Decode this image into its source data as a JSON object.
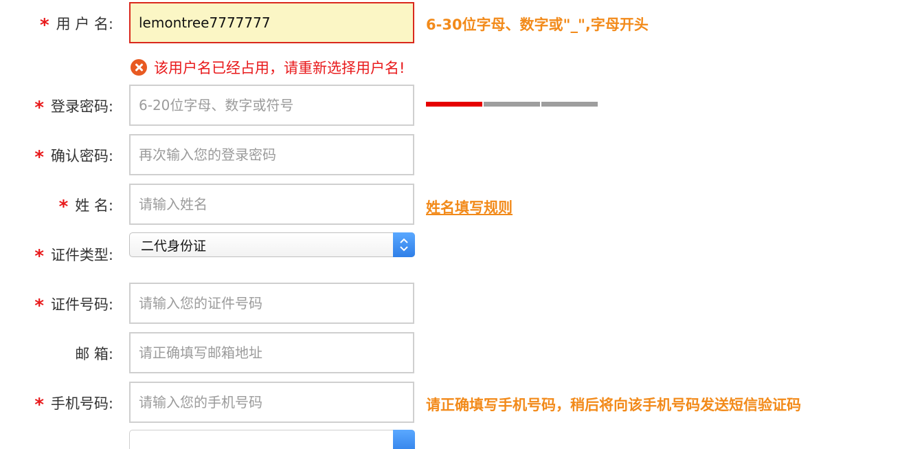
{
  "form": {
    "username": {
      "label": "用 户 名:",
      "value": "lemontree7777777",
      "hint": "6-30位字母、数字或\"_\",字母开头",
      "error": "该用户名已经占用，请重新选择用户名!"
    },
    "password": {
      "label": "登录密码:",
      "placeholder": "6-20位字母、数字或符号",
      "strength_level": 1,
      "strength_total": 3
    },
    "confirm_password": {
      "label": "确认密码:",
      "placeholder": "再次输入您的登录密码"
    },
    "name": {
      "label": "姓 名:",
      "placeholder": "请输入姓名",
      "rules_link": "姓名填写规则"
    },
    "id_type": {
      "label": "证件类型:",
      "selected": "二代身份证"
    },
    "id_number": {
      "label": "证件号码:",
      "placeholder": "请输入您的证件号码"
    },
    "email": {
      "label": "邮 箱:",
      "placeholder": "请正确填写邮箱地址"
    },
    "phone": {
      "label": "手机号码:",
      "placeholder": "请输入您的手机号码",
      "hint": "请正确填写手机号码，稍后将向该手机号码发送短信验证码"
    },
    "required_mark": "*"
  },
  "colors": {
    "required": "#e8191b",
    "hint": "#f28a1a",
    "error": "#e8191b",
    "strength_on": "#e60000",
    "strength_off": "#9e9e9e"
  }
}
